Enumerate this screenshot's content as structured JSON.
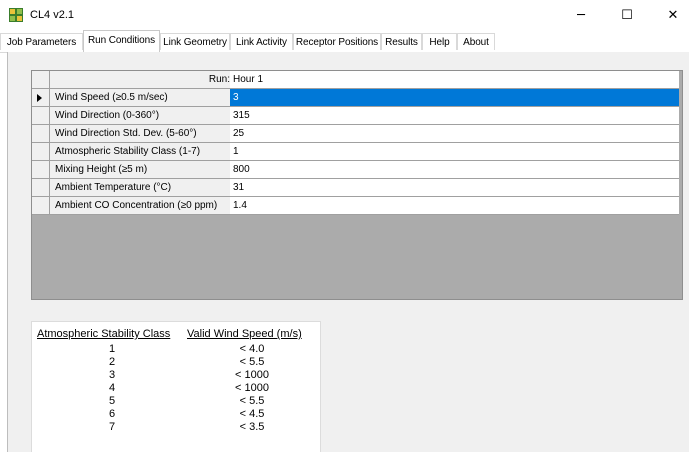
{
  "window": {
    "title": "CL4 v2.1",
    "icon": "app-grid-icon",
    "minimize_glyph": "─",
    "maximize_glyph": "☐",
    "close_glyph": "✕"
  },
  "tabs": [
    {
      "label": "Job Parameters",
      "active": false
    },
    {
      "label": "Run Conditions",
      "active": true
    },
    {
      "label": "Link Geometry",
      "active": false
    },
    {
      "label": "Link Activity",
      "active": false
    },
    {
      "label": "Receptor Positions",
      "active": false
    },
    {
      "label": "Results",
      "active": false
    },
    {
      "label": "Help",
      "active": false
    },
    {
      "label": "About",
      "active": false
    }
  ],
  "grid": {
    "header_label": "Run:",
    "header_value": "Hour 1",
    "rows": [
      {
        "label": "Wind Speed (≥0.5 m/sec)",
        "value": "3",
        "selected": true
      },
      {
        "label": "Wind Direction (0-360°)",
        "value": "315"
      },
      {
        "label": "Wind Direction Std. Dev. (5-60°)",
        "value": "25"
      },
      {
        "label": "Atmospheric Stability Class (1-7)",
        "value": "1"
      },
      {
        "label": "Mixing Height (≥5 m)",
        "value": "800"
      },
      {
        "label": "Ambient Temperature (°C)",
        "value": "31"
      },
      {
        "label": "Ambient CO Concentration (≥0 ppm)",
        "value": "1.4"
      }
    ],
    "selection_color": "#0078d7"
  },
  "stability_table": {
    "header_class": "Atmospheric Stability Class",
    "header_speed": "Valid Wind Speed (m/s)",
    "rows": [
      {
        "class": "1",
        "speed": "< 4.0"
      },
      {
        "class": "2",
        "speed": "< 5.5"
      },
      {
        "class": "3",
        "speed": "< 1000"
      },
      {
        "class": "4",
        "speed": "< 1000"
      },
      {
        "class": "5",
        "speed": "< 5.5"
      },
      {
        "class": "6",
        "speed": "< 4.5"
      },
      {
        "class": "7",
        "speed": "< 3.5"
      }
    ]
  }
}
